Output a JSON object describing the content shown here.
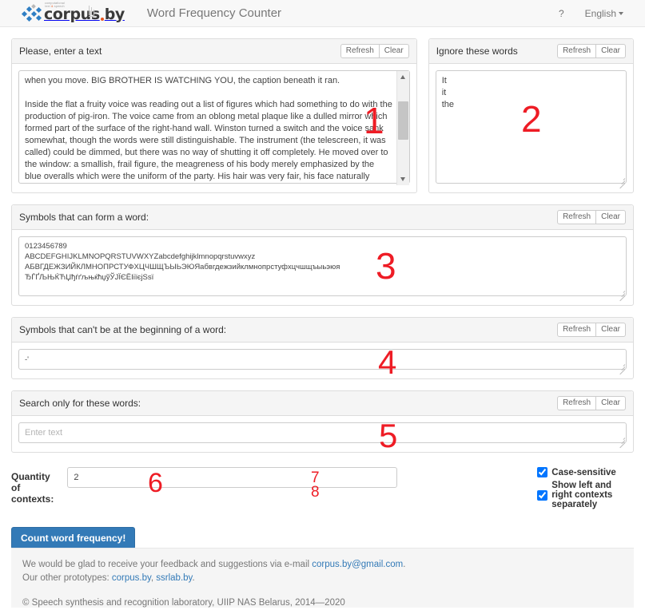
{
  "header": {
    "logo_mark": "corpus-by-logo",
    "logo_word_main": "corpus",
    "logo_word_suffix": "by",
    "logo_tagline_line1": "computational",
    "logo_tagline_line2a": "text ",
    "logo_tagline_amp": "&",
    "logo_tagline_line2b": " speech",
    "title": "Word Frequency Counter",
    "help_label": "?",
    "language_label": "English"
  },
  "buttons": {
    "refresh": "Refresh",
    "clear": "Clear"
  },
  "text_panel": {
    "title": "Please, enter a text",
    "value": "when you move. BIG BROTHER IS WATCHING YOU, the caption beneath it ran.\n\nInside the flat a fruity voice was reading out a list of figures which had something to do with the production of pig-iron. The voice came from an oblong metal plaque like a dulled mirror which formed part of the surface of the right-hand wall. Winston turned a switch and the voice sank somewhat, though the words were still distinguishable. The instrument (the telescreen, it was called) could be dimmed, but there was no way of shutting it off completely. He moved over to the window: a smallish, frail figure, the meagreness of his body merely emphasized by the blue overalls which were the uniform of the party. His hair was very fair, his face naturally sanguine, his skin roughened by coarse soap and blunt razor blades and the cold of the winter that had just ended."
  },
  "ignore_panel": {
    "title": "Ignore these words",
    "value": "It\nit\nthe"
  },
  "symbols_word_panel": {
    "title": "Symbols that can form a word:",
    "value": "0123456789\nABCDEFGHIJKLMNOPQRSTUVWXYZabcdefghijklmnopqrstuvwxyz\nАБВГДЕЖЗИЙКЛМНОПРСТУФХЦЧШЩЪЫЬЭЮЯабвгдежзийклмнопрстуфхцчшщъыьэюя\nЂЃҐЉЊЌЋЏђѓґљњќћџўЎЈЇЄЁІіїєјЅѕї"
  },
  "symbols_begin_panel": {
    "title": "Symbols that can't be at the beginning of a word:",
    "value": "-'"
  },
  "search_panel": {
    "title": "Search only for these words:",
    "value": "",
    "placeholder": "Enter text"
  },
  "controls": {
    "quantity_label": "Quantity of contexts:",
    "quantity_value": "2",
    "case_sensitive_label": "Case-sensitive",
    "case_sensitive_checked": true,
    "separate_contexts_label": "Show left and right contexts separately",
    "separate_contexts_checked": true,
    "submit_label": "Count word frequency!"
  },
  "footer": {
    "line1_prefix": "We would be glad to receive your feedback and suggestions via e-mail ",
    "email": "corpus.by@gmail.com",
    "line1_suffix": ".",
    "line2_prefix": "Our other prototypes: ",
    "link1": "corpus.by",
    "line2_mid": ", ",
    "link2": "ssrlab.by",
    "line2_suffix": ".",
    "copyright": "© Speech synthesis and recognition laboratory, UIIP NAS Belarus, 2014—2020"
  },
  "annotations": [
    {
      "label": "1"
    },
    {
      "label": "2"
    },
    {
      "label": "3"
    },
    {
      "label": "4"
    },
    {
      "label": "5"
    },
    {
      "label": "6"
    },
    {
      "label": "7"
    },
    {
      "label": "8"
    }
  ],
  "colors": {
    "primary": "#337ab7",
    "annotation": "#ee1c25",
    "panel_heading": "#f5f5f5",
    "border": "#dddddd"
  }
}
